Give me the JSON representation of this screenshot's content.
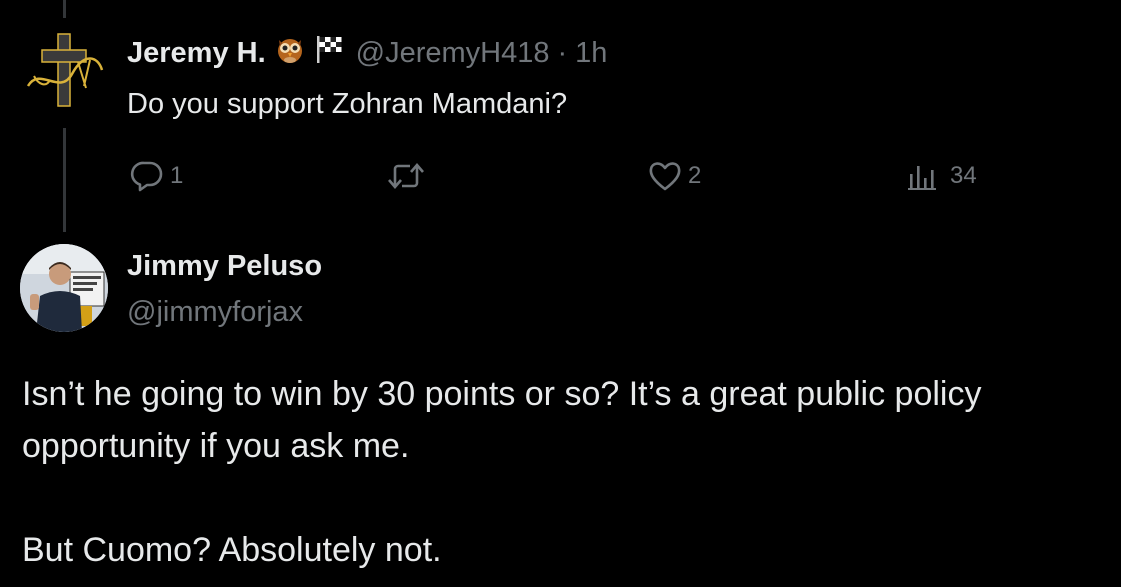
{
  "tweet1": {
    "display_name": "Jeremy H.",
    "emoji_badges": [
      "owl-emoji",
      "checkered-flag-emoji"
    ],
    "handle": "@JeremyH418",
    "separator": "·",
    "time": "1h",
    "text": "Do you support Zohran Mamdani?",
    "avatar": "cross-logo-avatar",
    "actions": {
      "reply_icon": "reply-icon",
      "reply_count": "1",
      "retweet_icon": "retweet-icon",
      "like_icon": "heart-icon",
      "like_count": "2",
      "views_icon": "views-icon",
      "views_count": "34"
    }
  },
  "tweet2": {
    "display_name": "Jimmy Peluso",
    "handle": "@jimmyforjax",
    "avatar": "person-photo-avatar",
    "body": [
      "Isn’t he going to win by 30 points or so? It’s a great public policy opportunity if you ask me.",
      "But Cuomo? Absolutely not."
    ]
  },
  "colors": {
    "background": "#000000",
    "text_primary": "#e7e9ea",
    "text_secondary": "#71767b",
    "thread_line": "#333639",
    "logo_gold": "#d9b23a"
  }
}
